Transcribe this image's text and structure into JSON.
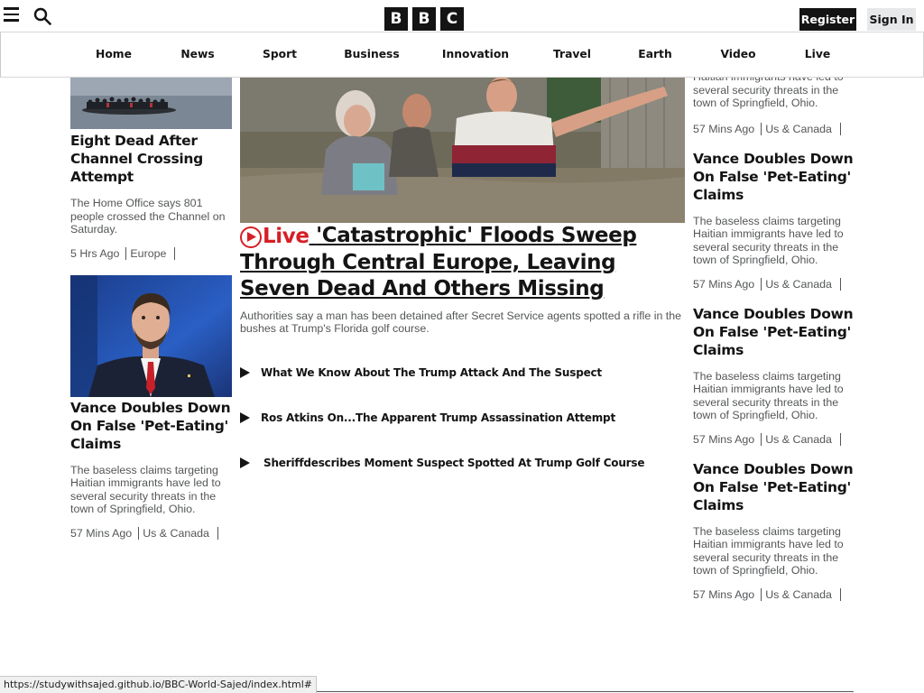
{
  "header": {
    "menu_icon": "hamburger-icon",
    "search_icon": "search-icon",
    "logo_letters": [
      "B",
      "B",
      "C"
    ],
    "register_label": "Register",
    "signin_label": "Sign In"
  },
  "nav": {
    "items": [
      {
        "label": "Home"
      },
      {
        "label": "News"
      },
      {
        "label": "Sport"
      },
      {
        "label": "Business"
      },
      {
        "label": "Innovation"
      },
      {
        "label": "Travel"
      },
      {
        "label": "Earth"
      },
      {
        "label": "Video"
      },
      {
        "label": "Live"
      }
    ]
  },
  "left": {
    "stories": [
      {
        "title": "Eight Dead After Channel Crossing Attempt",
        "summary": "The Home Office says 801 people crossed the Channel on Saturday.",
        "time": "5 Hrs Ago",
        "section": "Europe"
      },
      {
        "title": "Vance Doubles Down On False 'Pet-Eating' Claims",
        "summary": "The baseless claims targeting Haitian immigrants have led to several security threats in the town of Springfield, Ohio.",
        "time": "57 Mins Ago",
        "section": "Us & Canada"
      }
    ]
  },
  "hero": {
    "live_label": "Live",
    "title": "'Catastrophic' Floods Sweep Through Central Europe, Leaving Seven Dead And Others Missing",
    "summary": "Authorities say a man has been detained after Secret Service agents spotted a rifle in the bushes at Trump's Florida golf course.",
    "related": [
      {
        "label": "What We Know About The Trump Attack And The Suspect"
      },
      {
        "label": "Ros Atkins On...The Apparent Trump Assassination Attempt"
      },
      {
        "label": "Sheriffdescribes Moment Suspect Spotted At Trump Golf Course"
      }
    ]
  },
  "right": {
    "partial_summary": "Haitian immigrants have led to several security threats in the town of Springfield, Ohio.",
    "partial_time": "57 Mins Ago",
    "partial_section": "Us & Canada",
    "stories": [
      {
        "title": "Vance Doubles Down On False 'Pet-Eating' Claims",
        "summary": "The baseless claims targeting Haitian immigrants have led to several security threats in the town of Springfield, Ohio.",
        "time": "57 Mins Ago",
        "section": "Us & Canada"
      },
      {
        "title": "Vance Doubles Down On False 'Pet-Eating' Claims",
        "summary": "The baseless claims targeting Haitian immigrants have led to several security threats in the town of Springfield, Ohio.",
        "time": "57 Mins Ago",
        "section": "Us & Canada"
      },
      {
        "title": "Vance Doubles Down On False 'Pet-Eating' Claims",
        "summary": "The baseless claims targeting Haitian immigrants have led to several security threats in the town of Springfield, Ohio.",
        "time": "57 Mins Ago",
        "section": "Us & Canada"
      }
    ]
  },
  "statusbar": {
    "url": "https://studywithsajed.github.io/BBC-World-Sajed/index.html#"
  },
  "colors": {
    "ink": "#141414",
    "muted": "#545658",
    "live_red": "#d61f26",
    "signin_bg": "#e6e8ea"
  }
}
